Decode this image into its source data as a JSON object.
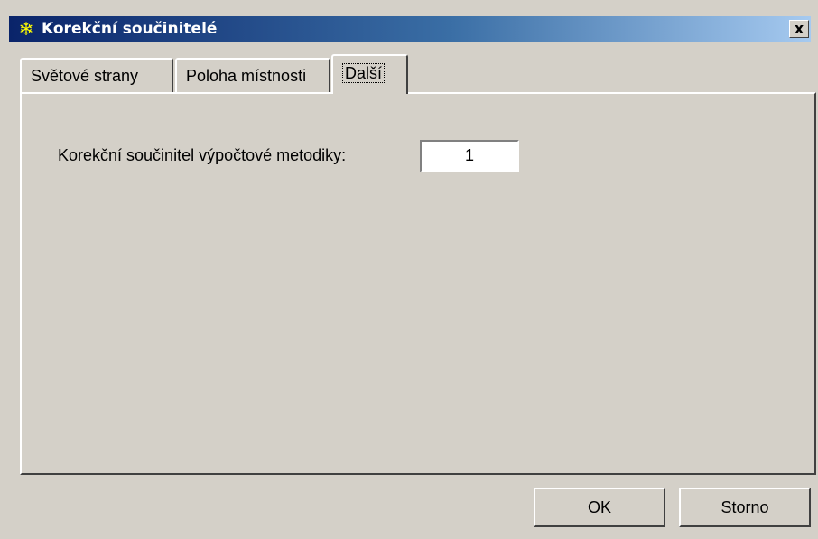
{
  "window": {
    "title": "Korekční součinitelé",
    "title_icon": "snowflake-icon",
    "close_label": "x"
  },
  "tabs": [
    {
      "label": "Světové strany"
    },
    {
      "label": "Poloha místnosti"
    },
    {
      "label": "Další",
      "active": true
    }
  ],
  "panel": {
    "field_label": "Korekční součinitel výpočtové metodiky:",
    "field_value": "1"
  },
  "buttons": {
    "ok": "OK",
    "cancel": "Storno"
  },
  "colors": {
    "titlebar_start": "#0a246a",
    "titlebar_end": "#a6caf0",
    "face": "#d4d0c8"
  }
}
